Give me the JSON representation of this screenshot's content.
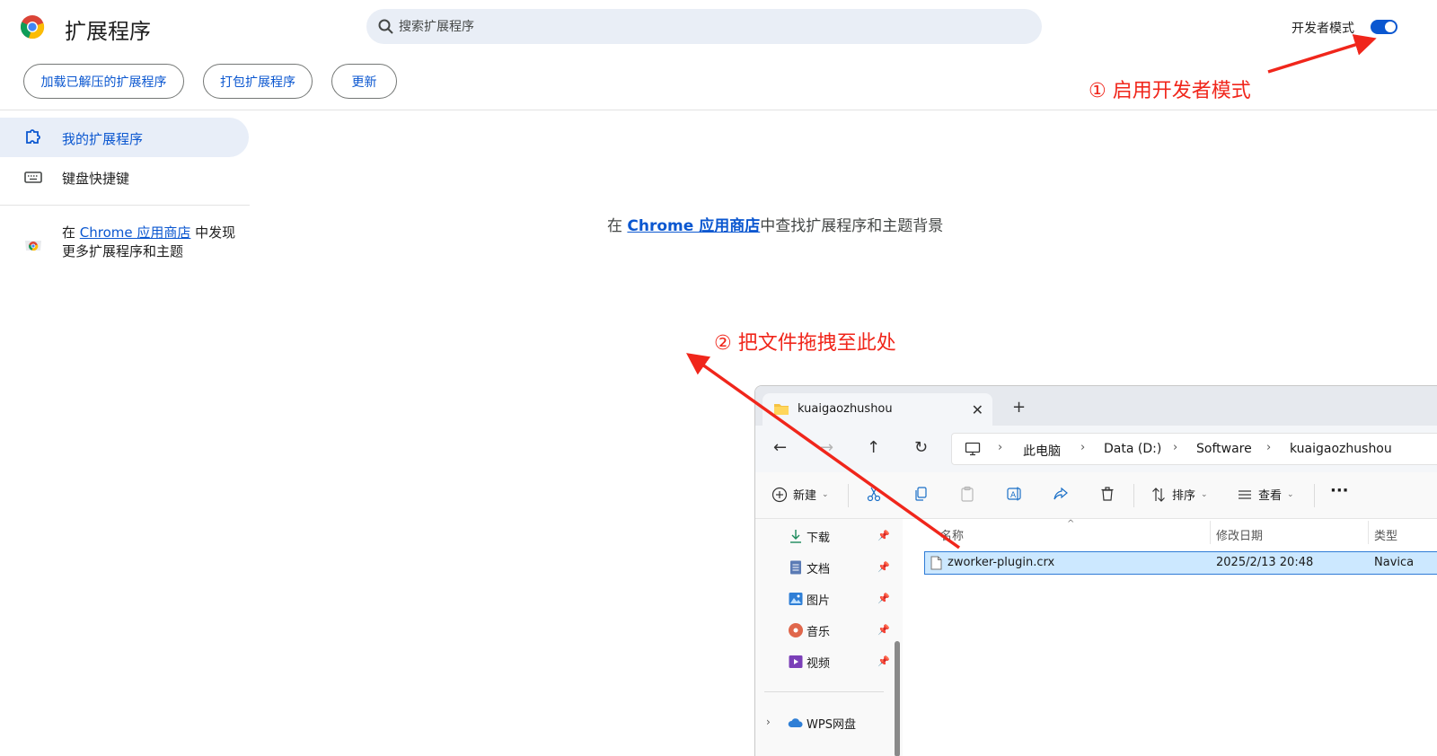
{
  "header": {
    "title": "扩展程序",
    "search_placeholder": "搜索扩展程序",
    "dev_mode_label": "开发者模式",
    "dev_mode_enabled": true
  },
  "toolbar": {
    "load_unpacked": "加载已解压的扩展程序",
    "pack": "打包扩展程序",
    "update": "更新"
  },
  "sidebar": {
    "items": [
      {
        "label": "我的扩展程序",
        "icon": "puzzle-icon",
        "active": true
      },
      {
        "label": "键盘快捷键",
        "icon": "keyboard-icon",
        "active": false
      }
    ],
    "store_prefix": "在 ",
    "store_link": "Chrome 应用商店",
    "store_suffix": " 中发现更多扩展程序和主题"
  },
  "main": {
    "prefix": "在 ",
    "link": "Chrome 应用商店",
    "suffix": "中查找扩展程序和主题背景"
  },
  "annotations": {
    "step1": "① 启用开发者模式",
    "step2": "② 把文件拖拽至此处",
    "color": "#f0261b"
  },
  "explorer": {
    "tab_title": "kuaigaozhushou",
    "new_tab": "+",
    "close": "✕",
    "breadcrumb": [
      "此电脑",
      "Data (D:)",
      "Software",
      "kuaigaozhushou"
    ],
    "commands": {
      "new": "新建",
      "sort": "排序",
      "view": "查看",
      "more": "···"
    },
    "quick_access": [
      {
        "label": "下载",
        "icon": "download-icon"
      },
      {
        "label": "文档",
        "icon": "document-icon"
      },
      {
        "label": "图片",
        "icon": "picture-icon"
      },
      {
        "label": "音乐",
        "icon": "music-icon"
      },
      {
        "label": "视频",
        "icon": "video-icon"
      }
    ],
    "cloud_item": {
      "label": "WPS网盘",
      "icon": "cloud-icon"
    },
    "columns": {
      "name": "名称",
      "modified": "修改日期",
      "type": "类型"
    },
    "files": [
      {
        "name": "zworker-plugin.crx",
        "modified": "2025/2/13 20:48",
        "type": "Navica",
        "selected": true
      }
    ]
  },
  "colors": {
    "accent": "#0b57d0",
    "sidebar_active_bg": "#e8eef8",
    "search_bg": "#e9eef6",
    "selection_bg": "#cce8ff"
  }
}
